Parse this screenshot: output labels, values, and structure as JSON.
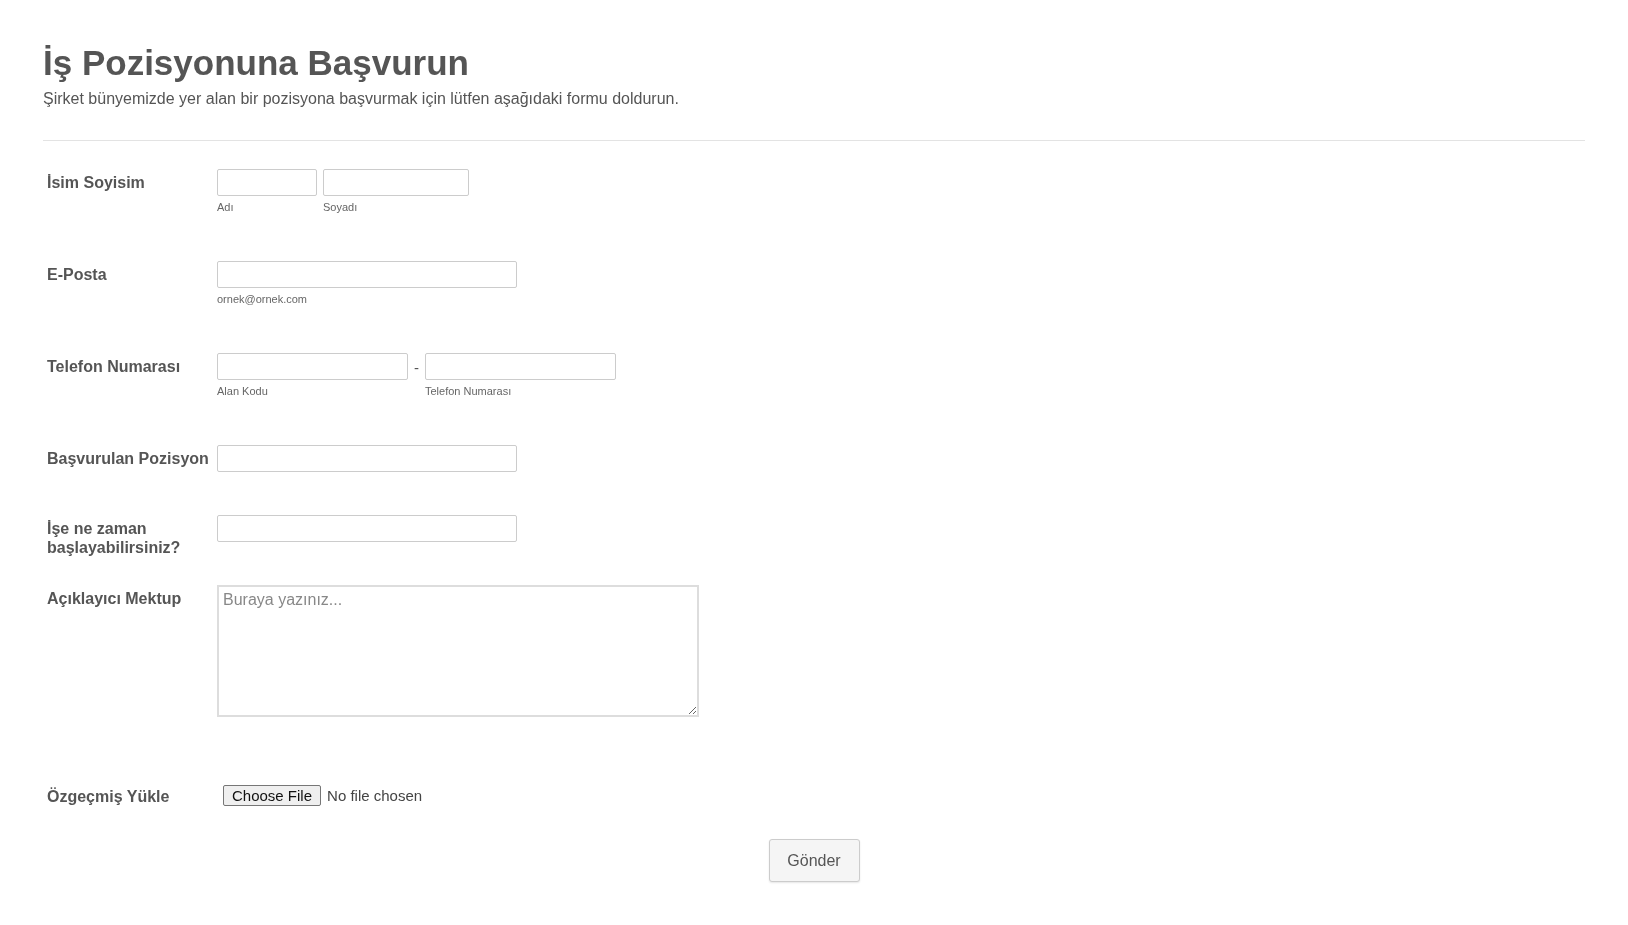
{
  "header": {
    "title": "İş Pozisyonuna Başvurun",
    "subtitle": "Şirket bünyemizde yer alan bir pozisyona başvurmak için lütfen aşağıdaki formu doldurun."
  },
  "fields": [
    {
      "kind": "name",
      "label": "İsim Soyisim",
      "parts": [
        {
          "sublabel": "Adı"
        },
        {
          "sublabel": "Soyadı"
        }
      ]
    },
    {
      "kind": "single",
      "label": "E-Posta",
      "sublabel": "ornek@ornek.com"
    },
    {
      "kind": "phone",
      "label": "Telefon Numarası",
      "separator": "-",
      "parts": [
        {
          "sublabel": "Alan Kodu"
        },
        {
          "sublabel": "Telefon Numarası"
        }
      ]
    },
    {
      "kind": "single",
      "label": "Başvurulan Pozisyon"
    },
    {
      "kind": "single",
      "label": "İşe ne zaman başlayabilirsiniz?"
    },
    {
      "kind": "textarea",
      "label": "Açıklayıcı Mektup",
      "placeholder": "Buraya yazınız..."
    },
    {
      "kind": "file",
      "label": "Özgeçmiş Yükle",
      "button": "Choose File",
      "status": "No file chosen"
    }
  ],
  "submit": "Gönder"
}
